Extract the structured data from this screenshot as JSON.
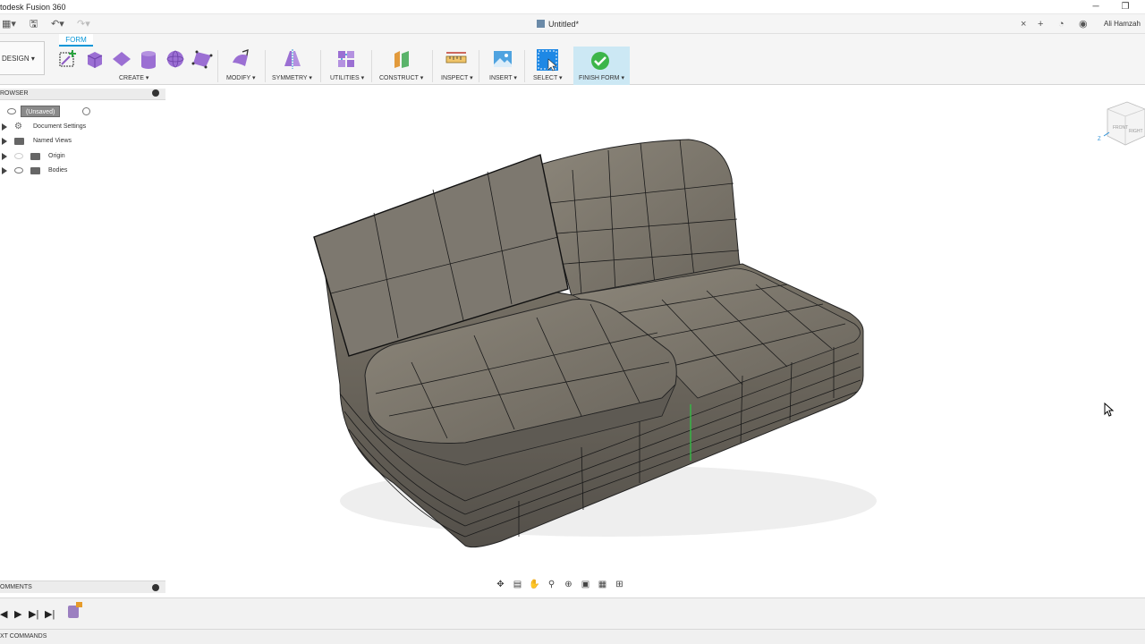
{
  "window": {
    "app_title": "todesk Fusion 360",
    "minimize_icon": "minimize-icon",
    "restore_icon": "restore-icon"
  },
  "qat": {
    "doc_tab": "Untitled*",
    "user": "Ali Hamzah"
  },
  "ribbon": {
    "workspace": "DESIGN ▾",
    "active_tab": "FORM",
    "groups": [
      {
        "label": "CREATE ▾"
      },
      {
        "label": "MODIFY ▾"
      },
      {
        "label": "SYMMETRY ▾"
      },
      {
        "label": "UTILITIES ▾"
      },
      {
        "label": "CONSTRUCT ▾"
      },
      {
        "label": "INSPECT ▾"
      },
      {
        "label": "INSERT ▾"
      },
      {
        "label": "SELECT ▾"
      },
      {
        "label": "FINISH FORM ▾"
      }
    ]
  },
  "browser": {
    "title": "ROWSER",
    "root": "(Unsaved)",
    "items": [
      {
        "label": "Document Settings"
      },
      {
        "label": "Named Views"
      },
      {
        "label": "Origin"
      },
      {
        "label": "Bodies"
      }
    ]
  },
  "comments": {
    "title": "OMMENTS"
  },
  "text_commands": {
    "title": "XT COMMANDS"
  },
  "viewcube": {
    "front": "FRONT",
    "right": "RIGHT",
    "axis_z": "Z"
  },
  "colors": {
    "accent": "#0696d7",
    "finish_bg": "#cce8f4",
    "finish_check": "#3cb54a",
    "model_fill": "#6f6a60",
    "mesh_line": "#1a1a1a"
  }
}
